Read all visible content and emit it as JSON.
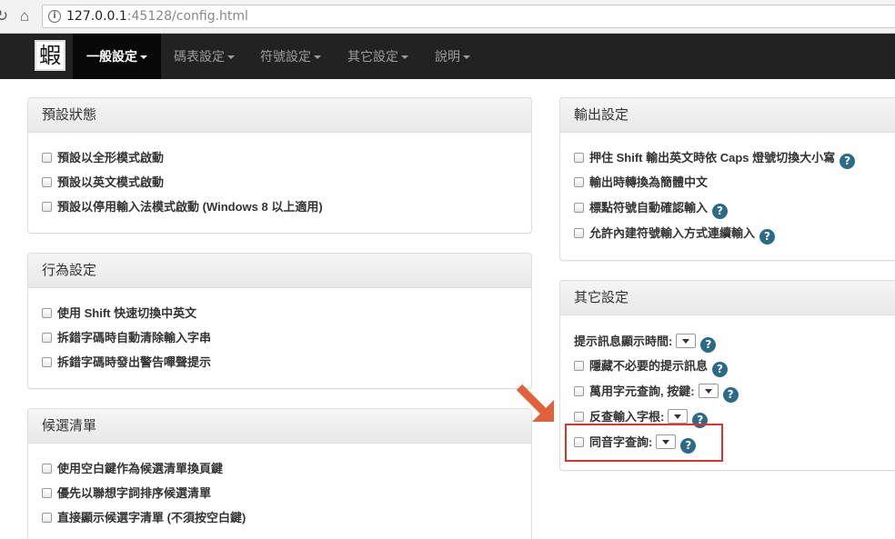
{
  "browser": {
    "url_host": "127.0.0.1",
    "url_rest": ":45128/config.html",
    "icons": {
      "back": "back-arrow-icon",
      "reload": "reload-icon",
      "home": "home-icon",
      "info": "info-icon"
    }
  },
  "navbar": {
    "brand": "蝦",
    "items": [
      {
        "label": "一般設定"
      },
      {
        "label": "碼表設定"
      },
      {
        "label": "符號設定"
      },
      {
        "label": "其它設定"
      },
      {
        "label": "說明"
      }
    ]
  },
  "panels": {
    "default_state": {
      "title": "預設狀態",
      "items": [
        {
          "label": "預設以全形模式啟動"
        },
        {
          "label": "預設以英文模式啟動"
        },
        {
          "label": "預設以停用輸入法模式啟動 (Windows 8 以上適用)"
        }
      ]
    },
    "behavior": {
      "title": "行為設定",
      "items": [
        {
          "label": "使用 Shift 快速切換中英文"
        },
        {
          "label": "拆錯字碼時自動清除輸入字串"
        },
        {
          "label": "拆錯字碼時發出警告嗶聲提示"
        }
      ]
    },
    "candidates": {
      "title": "候選清單",
      "items": [
        {
          "label": "使用空白鍵作為候選清單換頁鍵"
        },
        {
          "label": "優先以聯想字詞排序候選清單"
        },
        {
          "label": "直接顯示候選字清單 (不須按空白鍵)"
        }
      ]
    },
    "output": {
      "title": "輸出設定",
      "items": [
        {
          "label": "押住 Shift 輸出英文時依 Caps 燈號切換大小寫"
        },
        {
          "label": "輸出時轉換為簡體中文"
        },
        {
          "label": "標點符號自動確認輸入"
        },
        {
          "label": "允許內建符號輸入方式連續輸入"
        }
      ]
    },
    "other": {
      "title": "其它設定",
      "items": [
        {
          "label": "提示訊息顯示時間:"
        },
        {
          "label": "隱藏不必要的提示訊息"
        },
        {
          "label": "萬用字元查詢, 按鍵:"
        },
        {
          "label": "反查輸入字根:"
        },
        {
          "label": "同音字查詢:"
        }
      ]
    }
  },
  "help_glyph": "?",
  "colors": {
    "navbar_bg": "#222222",
    "help_icon": "#2a6b8a",
    "highlight": "#e03030",
    "arrow": "#e0623a"
  }
}
